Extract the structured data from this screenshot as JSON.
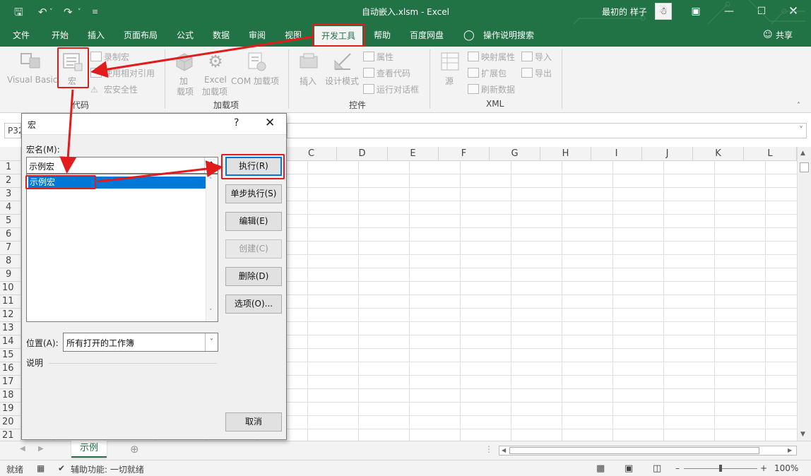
{
  "window": {
    "title": "自动嵌入.xlsm  -  Excel",
    "user_name": "最初的 样子"
  },
  "tabs": [
    "文件",
    "开始",
    "插入",
    "页面布局",
    "公式",
    "数据",
    "审阅",
    "视图",
    "开发工具",
    "帮助",
    "百度网盘",
    "操作说明搜索"
  ],
  "active_tab": "开发工具",
  "share_label": "共享",
  "ribbon": {
    "code": {
      "group_label": "代码",
      "visual_basic": "Visual Basic",
      "macros": "宏",
      "record_macro": "录制宏",
      "relative_refs": "使用相对引用",
      "macro_security": "宏安全性"
    },
    "addins": {
      "group_label": "加载项",
      "addins_1": "加",
      "addins_2": "载项",
      "excel_addins_1": "Excel",
      "excel_addins_2": "加载项",
      "com_addins": "COM 加载项"
    },
    "controls": {
      "group_label": "控件",
      "insert": "插入",
      "design_mode": "设计模式",
      "properties": "属性",
      "view_code": "查看代码",
      "run_dialog": "运行对话框"
    },
    "xml": {
      "group_label": "XML",
      "source": "源",
      "map_props": "映射属性",
      "expansion_packs": "扩展包",
      "refresh_data": "刷新数据",
      "import": "导入",
      "export": "导出"
    }
  },
  "namebox": "P32",
  "columns": [
    "C",
    "D",
    "E",
    "F",
    "G",
    "H",
    "I",
    "J",
    "K",
    "L"
  ],
  "rows": [
    "1",
    "2",
    "3",
    "4",
    "5",
    "6",
    "7",
    "8",
    "9",
    "10",
    "11",
    "12",
    "13",
    "14",
    "15",
    "16",
    "17",
    "18",
    "19",
    "20",
    "21"
  ],
  "sheet_tab": "示例",
  "status": {
    "ready": "就绪",
    "accessibility": "辅助功能: 一切就绪",
    "zoom": "100%"
  },
  "dialog": {
    "title": "宏",
    "macro_name_label": "宏名(M):",
    "macro_name_value": "示例宏",
    "list_items": [
      "示例宏"
    ],
    "buttons": {
      "run": "执行(R)",
      "step_into": "单步执行(S)",
      "edit": "编辑(E)",
      "create": "创建(C)",
      "delete": "删除(D)",
      "options": "选项(O)...",
      "cancel": "取消"
    },
    "location_label": "位置(A):",
    "location_value": "所有打开的工作簿",
    "description_label": "说明"
  },
  "colors": {
    "brand": "#217346",
    "highlight_box": "#e21b1b",
    "selection": "#0078d7"
  }
}
